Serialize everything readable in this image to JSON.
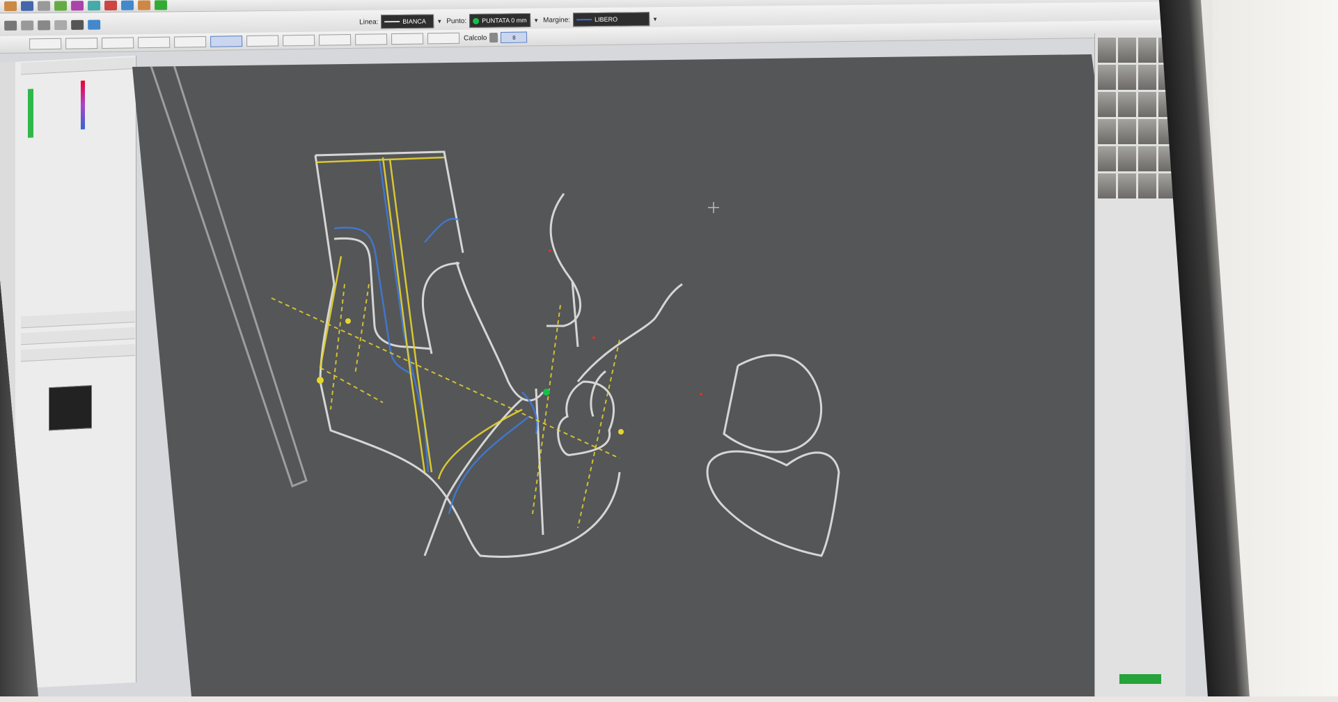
{
  "toolbar": {
    "linea_label": "Linea:",
    "linea_value": "BIANCA",
    "punto_label": "Punto:",
    "punto_value": "PUNTATA 0 mm",
    "margine_label": "Margine:",
    "margine_value": "LIBERO",
    "calcolo_label": "Calcolo",
    "calcolo_value": "8",
    "colors": {
      "linea": "#ffffff",
      "punto": "#15c04a",
      "margine": "#3d6ee0"
    }
  },
  "canvas": {
    "background": "#555657",
    "line_colors": {
      "outline": "#d6d6d6",
      "construction": "#e6d430",
      "guide": "#3f7be0",
      "point": "#e03030"
    }
  }
}
